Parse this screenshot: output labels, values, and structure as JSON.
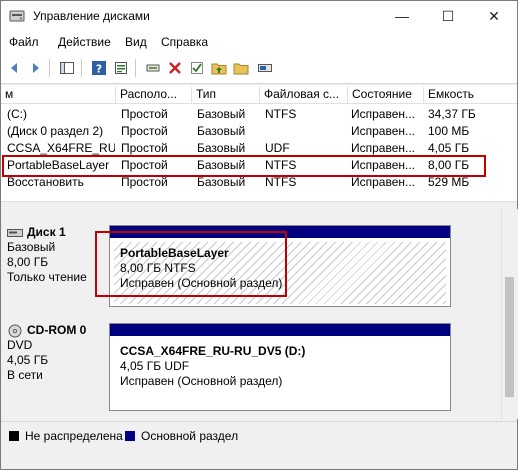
{
  "window": {
    "title": "Управление дисками",
    "minimize_glyph": "—",
    "maximize_glyph": "☐",
    "close_glyph": "✕"
  },
  "menu": [
    "Файл",
    "Действие",
    "Вид",
    "Справка"
  ],
  "toolbar": {
    "icons": [
      "back-icon",
      "forward-icon",
      "console-tree-icon",
      "help-icon",
      "properties-icon",
      "connect-icon",
      "delete-icon",
      "check-icon",
      "folder-up-icon",
      "folder-icon",
      "disk-view-icon"
    ]
  },
  "volume_list": {
    "columns": [
      "м",
      "Располо...",
      "Тип",
      "Файловая с...",
      "Состояние",
      "Емкость"
    ],
    "rows": [
      [
        "(C:)",
        "Простой",
        "Базовый",
        "NTFS",
        "Исправен...",
        "34,37 ГБ"
      ],
      [
        "(Диск 0 раздел 2)",
        "Простой",
        "Базовый",
        "",
        "Исправен...",
        "100 МБ"
      ],
      [
        "CCSA_X64FRE_RU-...",
        "Простой",
        "Базовый",
        "UDF",
        "Исправен...",
        "4,05 ГБ"
      ],
      [
        "PortableBaseLayer",
        "Простой",
        "Базовый",
        "NTFS",
        "Исправен...",
        "8,00 ГБ"
      ],
      [
        "Восстановить",
        "Простой",
        "Базовый",
        "NTFS",
        "Исправен...",
        "529 МБ"
      ]
    ],
    "highlighted_row": 3
  },
  "disks": [
    {
      "name": "Диск 1",
      "type": "Базовый",
      "size": "8,00 ГБ",
      "status": "Только чтение",
      "partition": {
        "name": "PortableBaseLayer",
        "size_fs": "8,00 ГБ NTFS",
        "status": "Исправен (Основной раздел)"
      }
    },
    {
      "name": "CD-ROM 0",
      "type": "DVD",
      "size": "4,05 ГБ",
      "status": "В сети",
      "partition": {
        "name": "CCSA_X64FRE_RU-RU_DV5  (D:)",
        "size_fs": "4,05 ГБ UDF",
        "status": "Исправен (Основной раздел)"
      }
    }
  ],
  "legend": [
    {
      "label": "Не распределена",
      "color": "#000000"
    },
    {
      "label": "Основной раздел",
      "color": "#000080"
    }
  ],
  "colors": {
    "highlight": "#c00000",
    "primary_partition": "#000080"
  }
}
